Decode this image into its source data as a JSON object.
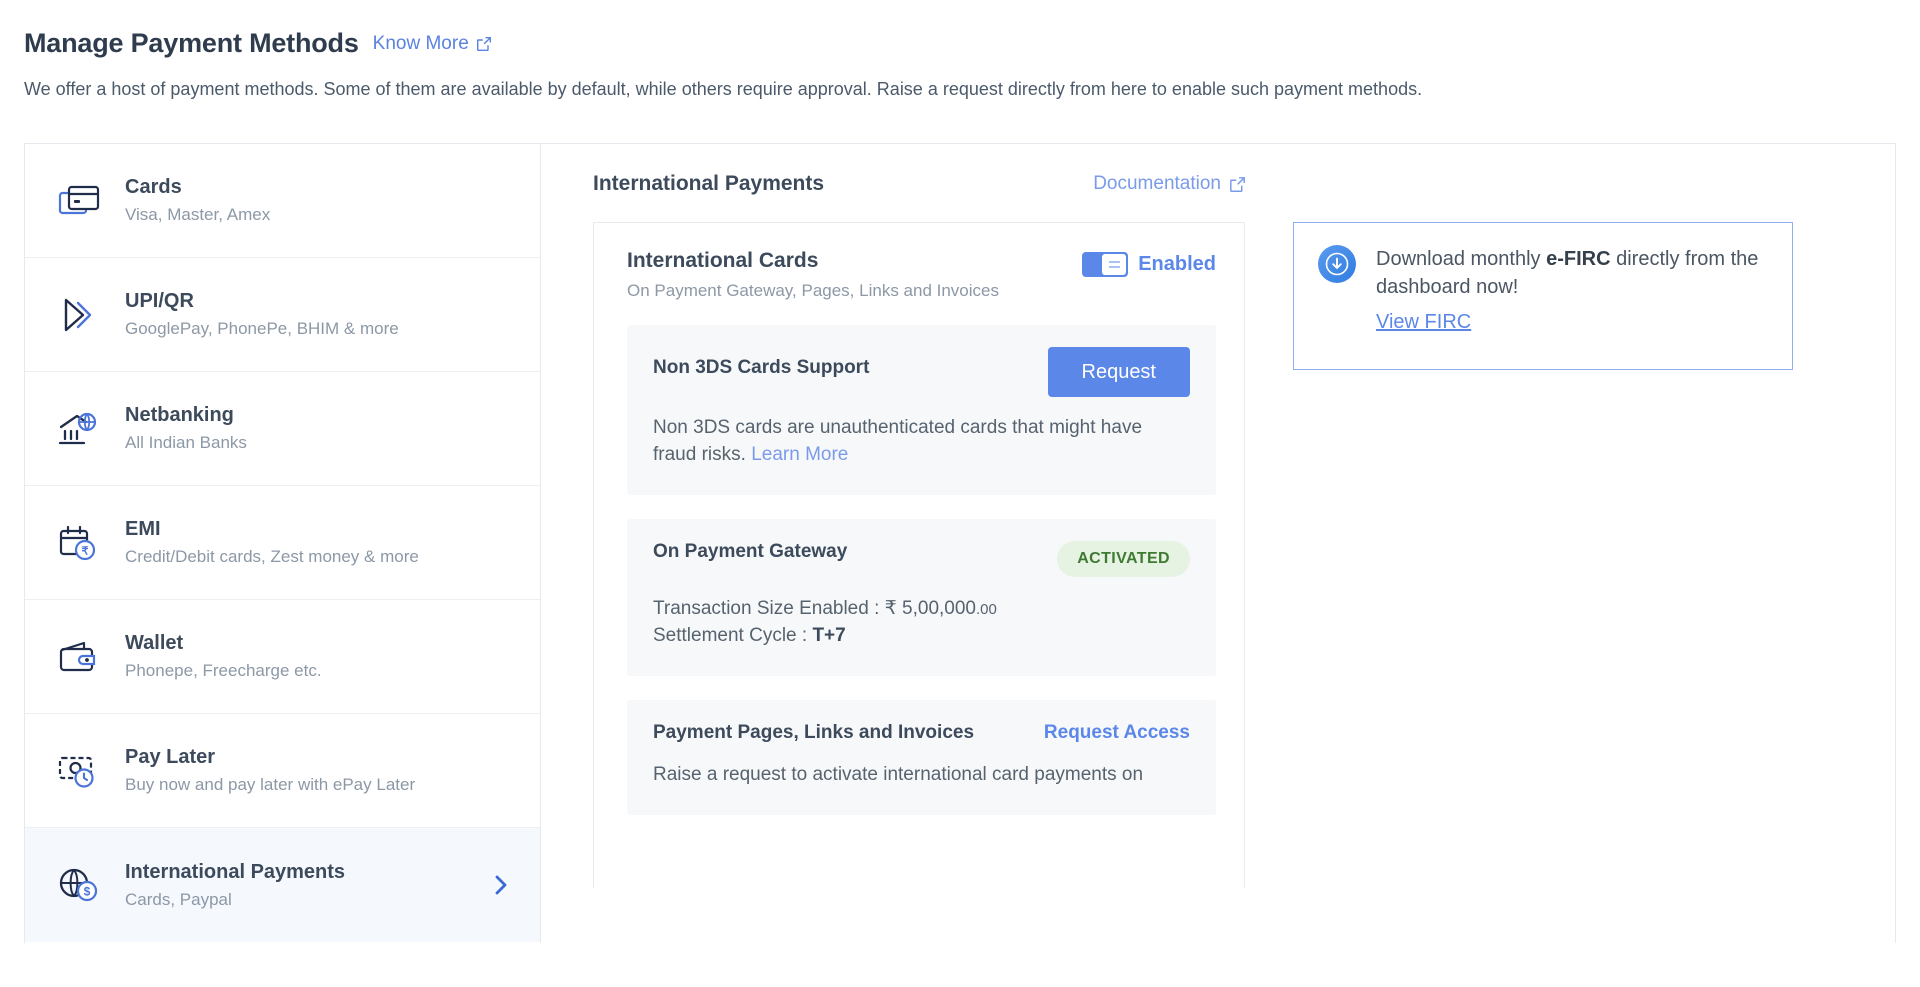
{
  "header": {
    "title": "Manage Payment Methods",
    "know_more": "Know More",
    "know_more_icon": "external-link-icon",
    "subtitle": "We offer a host of payment methods. Some of them are available by default, while others require approval. Raise a request directly from here to enable such payment methods."
  },
  "sidebar": {
    "items": [
      {
        "title": "Cards",
        "sub": "Visa, Master, Amex",
        "icon": "cards-icon",
        "active": false
      },
      {
        "title": "UPI/QR",
        "sub": "GooglePay, PhonePe, BHIM & more",
        "icon": "upi-qr-icon",
        "active": false
      },
      {
        "title": "Netbanking",
        "sub": "All Indian Banks",
        "icon": "netbanking-icon",
        "active": false
      },
      {
        "title": "EMI",
        "sub": "Credit/Debit cards, Zest money & more",
        "icon": "emi-calendar-icon",
        "active": false
      },
      {
        "title": "Wallet",
        "sub": "Phonepe, Freecharge etc.",
        "icon": "wallet-icon",
        "active": false
      },
      {
        "title": "Pay Later",
        "sub": "Buy now and pay later with ePay Later",
        "icon": "pay-later-icon",
        "active": false
      },
      {
        "title": "International Payments",
        "sub": "Cards, Paypal",
        "icon": "globe-dollar-icon",
        "active": true
      }
    ]
  },
  "main": {
    "title": "International Payments",
    "documentation_label": "Documentation",
    "documentation_icon": "external-link-icon",
    "international_cards": {
      "title": "International Cards",
      "subtitle": "On Payment Gateway, Pages, Links and Invoices",
      "toggle_state": "Enabled",
      "toggle_on": true
    },
    "cards": [
      {
        "title": "Non 3DS Cards Support",
        "action_type": "button",
        "action_label": "Request",
        "body": "Non 3DS cards are unauthenticated cards that might have fraud risks.",
        "body_link": "Learn More"
      },
      {
        "title": "On Payment Gateway",
        "action_type": "badge",
        "action_label": "ACTIVATED",
        "transaction_size_label": "Transaction Size Enabled : ",
        "transaction_currency": "₹",
        "transaction_amount": "5,00,000",
        "transaction_cents": ".00",
        "settlement_label": "Settlement Cycle : ",
        "settlement_value": "T+7"
      },
      {
        "title": "Payment Pages, Links and Invoices",
        "action_type": "link",
        "action_label": "Request Access",
        "body": "Raise a request to activate international card payments on"
      }
    ]
  },
  "firc": {
    "icon": "download-circle-icon",
    "text_before": "Download monthly ",
    "text_bold": "e-FIRC",
    "text_after": " directly from the dashboard now!",
    "link": "View FIRC"
  },
  "colors": {
    "accent_blue": "#5b87e8",
    "link_blue": "#7a9aea",
    "text_dark": "#3c4a5c",
    "text_muted": "#8c98a6",
    "badge_green_bg": "#e6f2e2",
    "badge_green_text": "#3f7a33",
    "icon_navy": "#1f2d4a",
    "active_row_bg": "#f5f8fd"
  }
}
